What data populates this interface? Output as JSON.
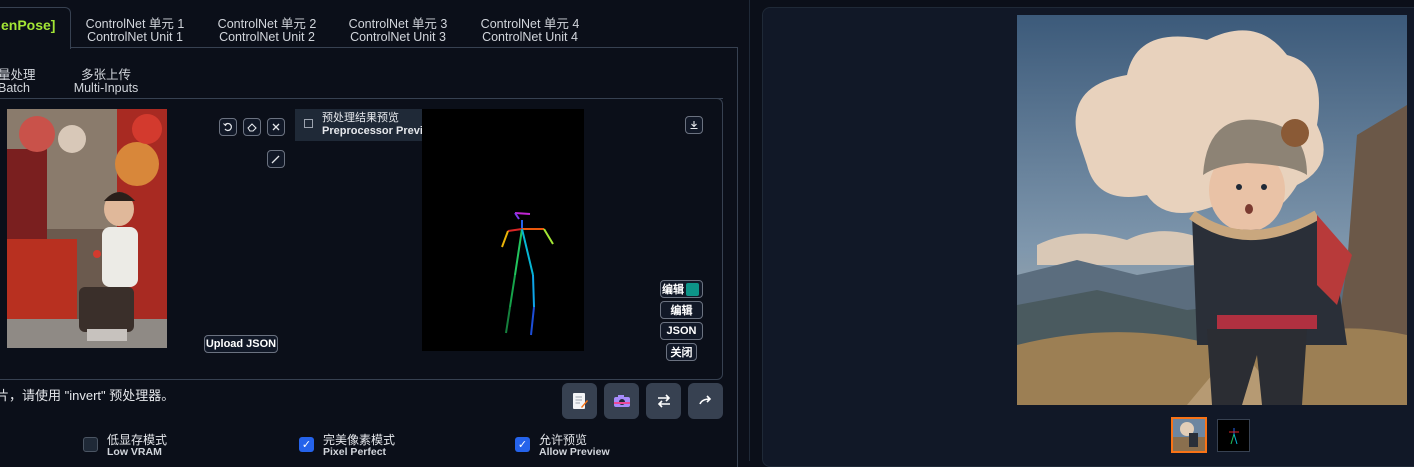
{
  "tabs": {
    "active": "enPose]",
    "units": [
      {
        "zh": "ControlNet 单元 1",
        "en": "ControlNet Unit 1"
      },
      {
        "zh": "ControlNet 单元 2",
        "en": "ControlNet Unit 2"
      },
      {
        "zh": "ControlNet 单元 3",
        "en": "ControlNet Unit 3"
      },
      {
        "zh": "ControlNet 单元 4",
        "en": "ControlNet Unit 4"
      }
    ]
  },
  "subtabs": [
    {
      "zh": "量处理",
      "en": "Batch"
    },
    {
      "zh": "多张上传",
      "en": "Multi-Inputs"
    }
  ],
  "preview": {
    "zh": "预处理结果预览",
    "en": "Preprocessor Preview"
  },
  "upload_json": "Upload JSON",
  "edit_buttons": [
    "编辑",
    "编辑",
    "JSON",
    "关闭"
  ],
  "hint": "片，请使用 \"invert\" 预处理器。",
  "options": [
    {
      "zh": "低显存模式",
      "en": "Low VRAM",
      "checked": false
    },
    {
      "zh": "完美像素模式",
      "en": "Pixel Perfect",
      "checked": true
    },
    {
      "zh": "允许预览",
      "en": "Allow Preview",
      "checked": true
    }
  ],
  "icons": {
    "undo": "undo-icon",
    "erase": "eraser-icon",
    "close": "close-icon",
    "brush": "brush-icon",
    "download": "download-icon",
    "image": "image-icon",
    "notepad": "notepad-icon",
    "camera": "camera-icon",
    "swap": "swap-icon",
    "send": "send-icon"
  },
  "colors": {
    "accent": "#a3e635",
    "check": "#2563eb",
    "thumb_selected": "#f97316"
  }
}
